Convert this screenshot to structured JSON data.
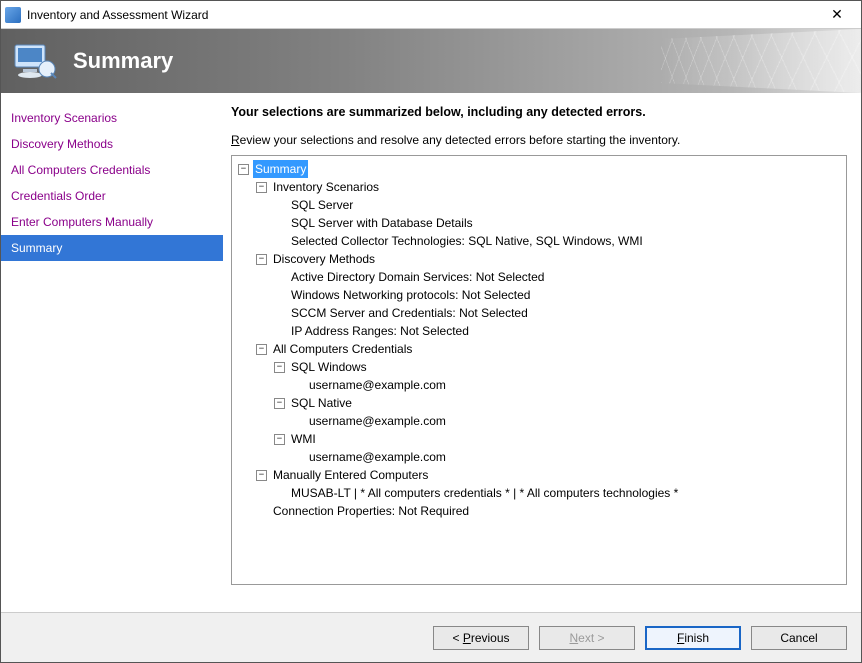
{
  "window": {
    "title": "Inventory and Assessment Wizard"
  },
  "banner": {
    "title": "Summary"
  },
  "sidebar": {
    "items": [
      {
        "label": "Inventory Scenarios",
        "state": "visited"
      },
      {
        "label": "Discovery Methods",
        "state": "visited"
      },
      {
        "label": "All Computers Credentials",
        "state": "visited"
      },
      {
        "label": "Credentials Order",
        "state": "visited"
      },
      {
        "label": "Enter Computers Manually",
        "state": "visited"
      },
      {
        "label": "Summary",
        "state": "active"
      }
    ]
  },
  "main": {
    "heading": "Your selections are summarized below, including any detected errors.",
    "subtext_prefix_accel": "R",
    "subtext_rest": "eview your selections and resolve any detected errors before starting the inventory."
  },
  "tree": [
    {
      "depth": 0,
      "expandable": true,
      "expanded": true,
      "selected": true,
      "label": "Summary"
    },
    {
      "depth": 1,
      "expandable": true,
      "expanded": true,
      "label": "Inventory Scenarios"
    },
    {
      "depth": 2,
      "expandable": false,
      "label": "SQL Server"
    },
    {
      "depth": 2,
      "expandable": false,
      "label": "SQL Server with Database Details"
    },
    {
      "depth": 2,
      "expandable": false,
      "label": "Selected Collector Technologies: SQL Native, SQL Windows, WMI"
    },
    {
      "depth": 1,
      "expandable": true,
      "expanded": true,
      "label": "Discovery Methods"
    },
    {
      "depth": 2,
      "expandable": false,
      "label": "Active Directory Domain Services: Not Selected"
    },
    {
      "depth": 2,
      "expandable": false,
      "label": "Windows Networking protocols: Not Selected"
    },
    {
      "depth": 2,
      "expandable": false,
      "label": "SCCM Server and Credentials: Not Selected"
    },
    {
      "depth": 2,
      "expandable": false,
      "label": "IP Address Ranges: Not Selected"
    },
    {
      "depth": 1,
      "expandable": true,
      "expanded": true,
      "label": "All Computers Credentials"
    },
    {
      "depth": 2,
      "expandable": true,
      "expanded": true,
      "label": "SQL Windows"
    },
    {
      "depth": 3,
      "expandable": false,
      "label": "username@example.com"
    },
    {
      "depth": 2,
      "expandable": true,
      "expanded": true,
      "label": "SQL Native"
    },
    {
      "depth": 3,
      "expandable": false,
      "label": "username@example.com"
    },
    {
      "depth": 2,
      "expandable": true,
      "expanded": true,
      "label": "WMI"
    },
    {
      "depth": 3,
      "expandable": false,
      "label": "username@example.com"
    },
    {
      "depth": 1,
      "expandable": true,
      "expanded": true,
      "label": "Manually Entered Computers"
    },
    {
      "depth": 2,
      "expandable": false,
      "label": "MUSAB-LT | * All computers credentials * | * All computers technologies *"
    },
    {
      "depth": 1,
      "expandable": false,
      "label": "Connection Properties: Not Required"
    }
  ],
  "buttons": {
    "previous_accel": "P",
    "previous_rest": "revious",
    "previous_prefix": "< ",
    "next_accel": "N",
    "next_rest": "ext >",
    "finish_accel": "F",
    "finish_rest": "inish",
    "cancel": "Cancel"
  }
}
